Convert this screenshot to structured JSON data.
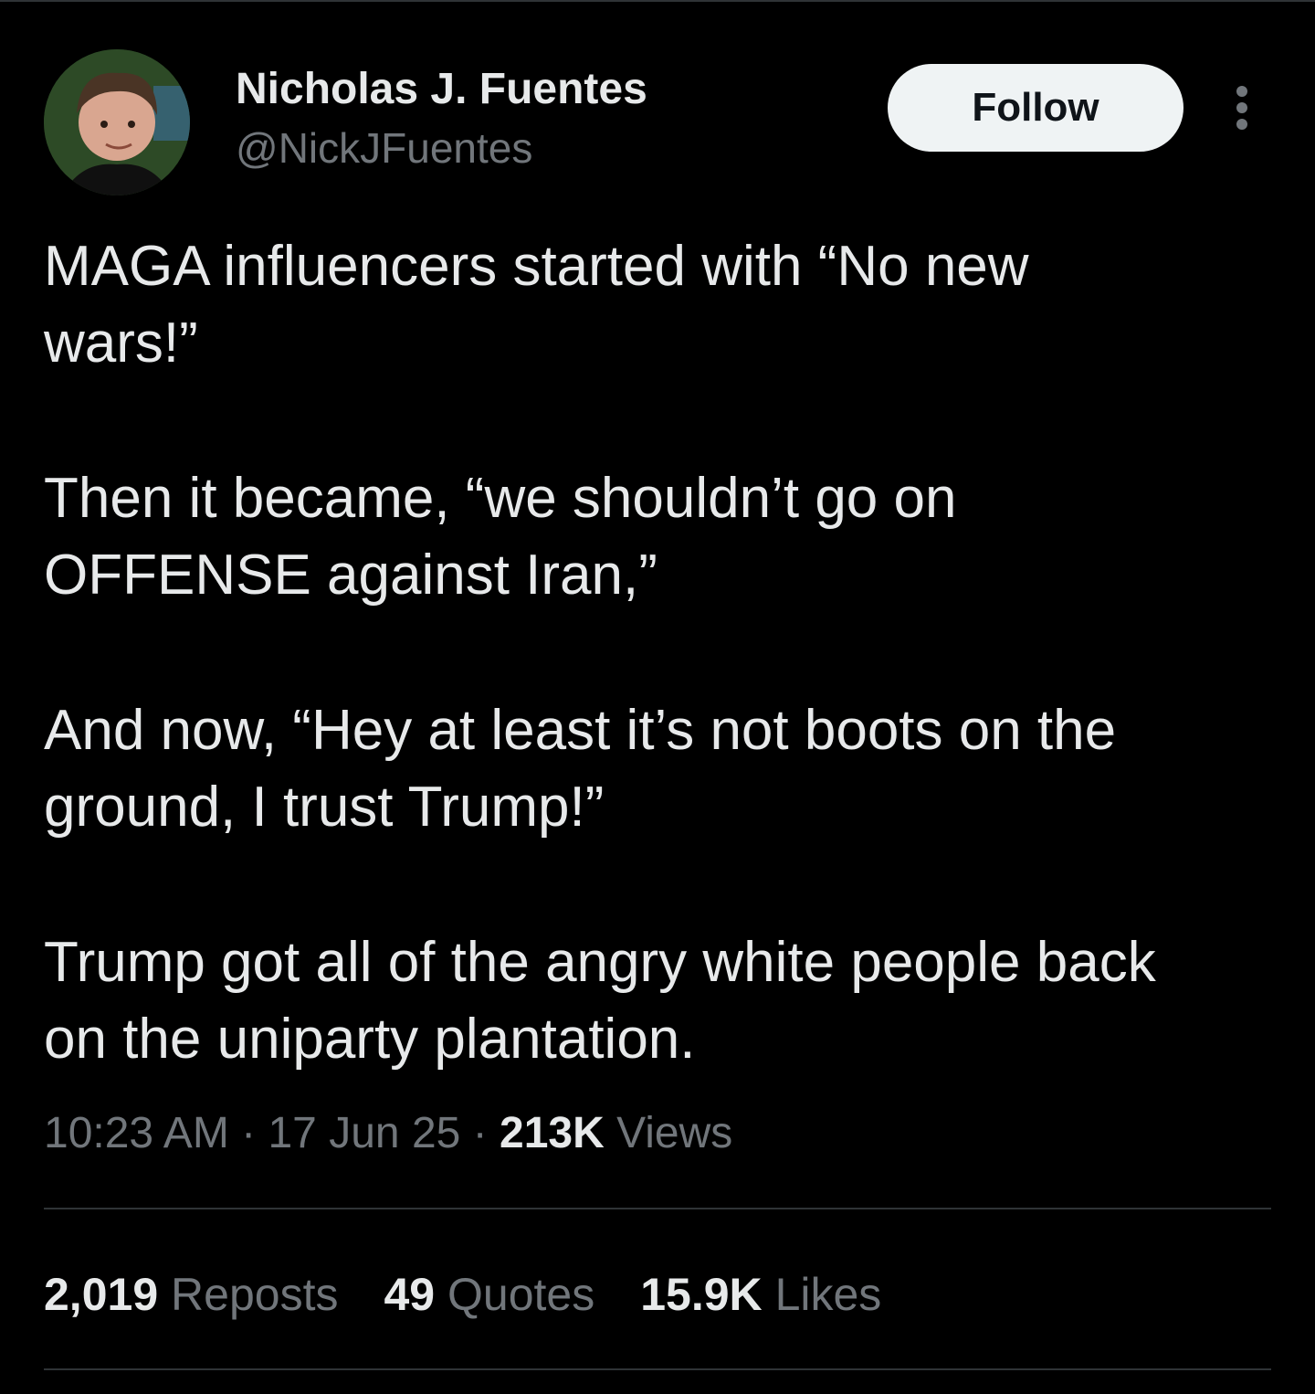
{
  "author": {
    "name": "Nicholas J. Fuentes",
    "handle": "@NickJFuentes"
  },
  "actions": {
    "follow_label": "Follow",
    "more_icon": "more-dots-vertical-icon"
  },
  "tweet": {
    "paragraphs": [
      "MAGA influencers started with “No new\nwars!”",
      "Then it became, “we shouldn’t go on\nOFFENSE against Iran,”",
      "And now, “Hey at least it’s not boots on the\nground, I trust Trump!”",
      "Trump got all of the angry white people back\non the uniparty plantation."
    ]
  },
  "meta": {
    "time": "10:23 AM",
    "separator": "·",
    "date": "17 Jun 25",
    "views_count": "213K",
    "views_label": "Views"
  },
  "stats": [
    {
      "count": "2,019",
      "label": "Reposts"
    },
    {
      "count": "49",
      "label": "Quotes"
    },
    {
      "count": "15.9K",
      "label": "Likes"
    }
  ],
  "colors": {
    "background": "#000000",
    "text_primary": "#e7e9ea",
    "text_secondary": "#71767b",
    "divider": "#2f3336",
    "follow_bg": "#eff3f4"
  }
}
